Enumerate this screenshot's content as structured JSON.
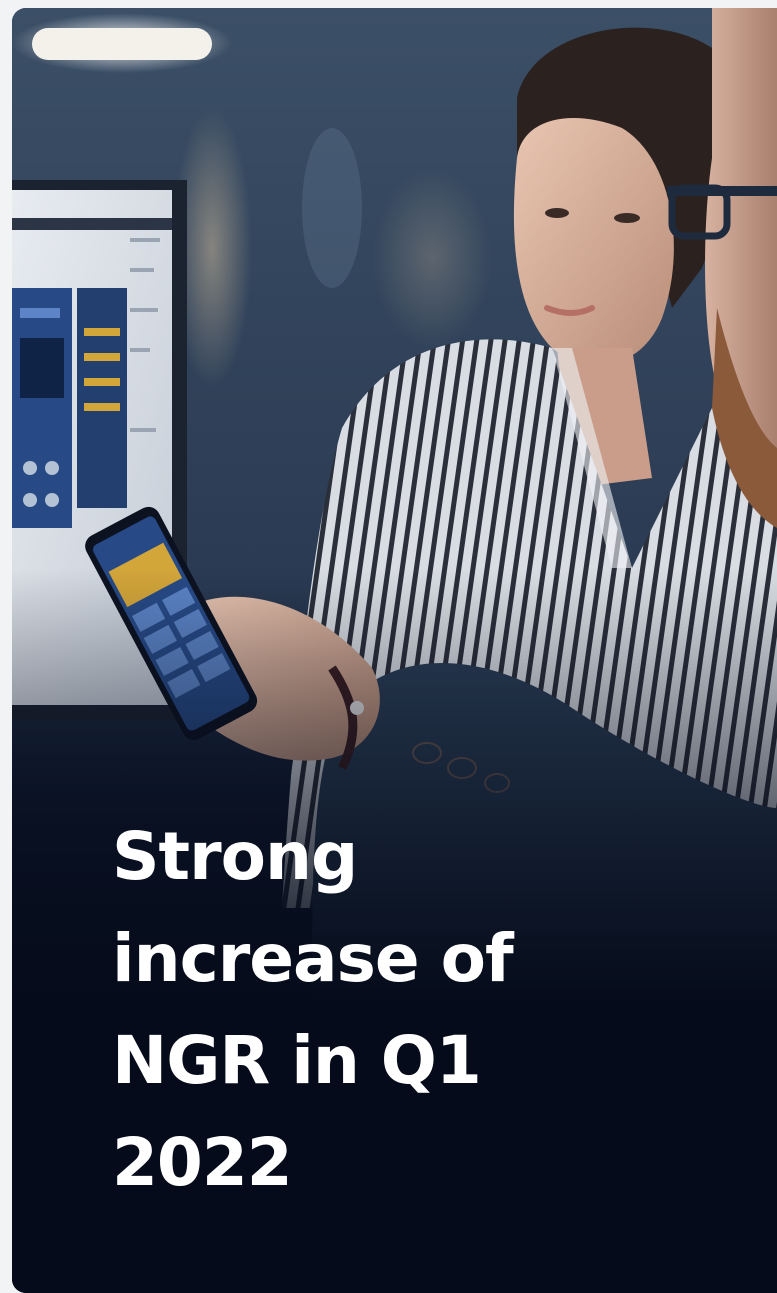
{
  "card": {
    "headline": "Strong increase of NGR in Q1 2022",
    "image_icon": "photo-people-looking-at-phone"
  },
  "colors": {
    "background": "#f2f3f5",
    "card_bottom": "#050b1a",
    "headline_text": "#ffffff"
  }
}
